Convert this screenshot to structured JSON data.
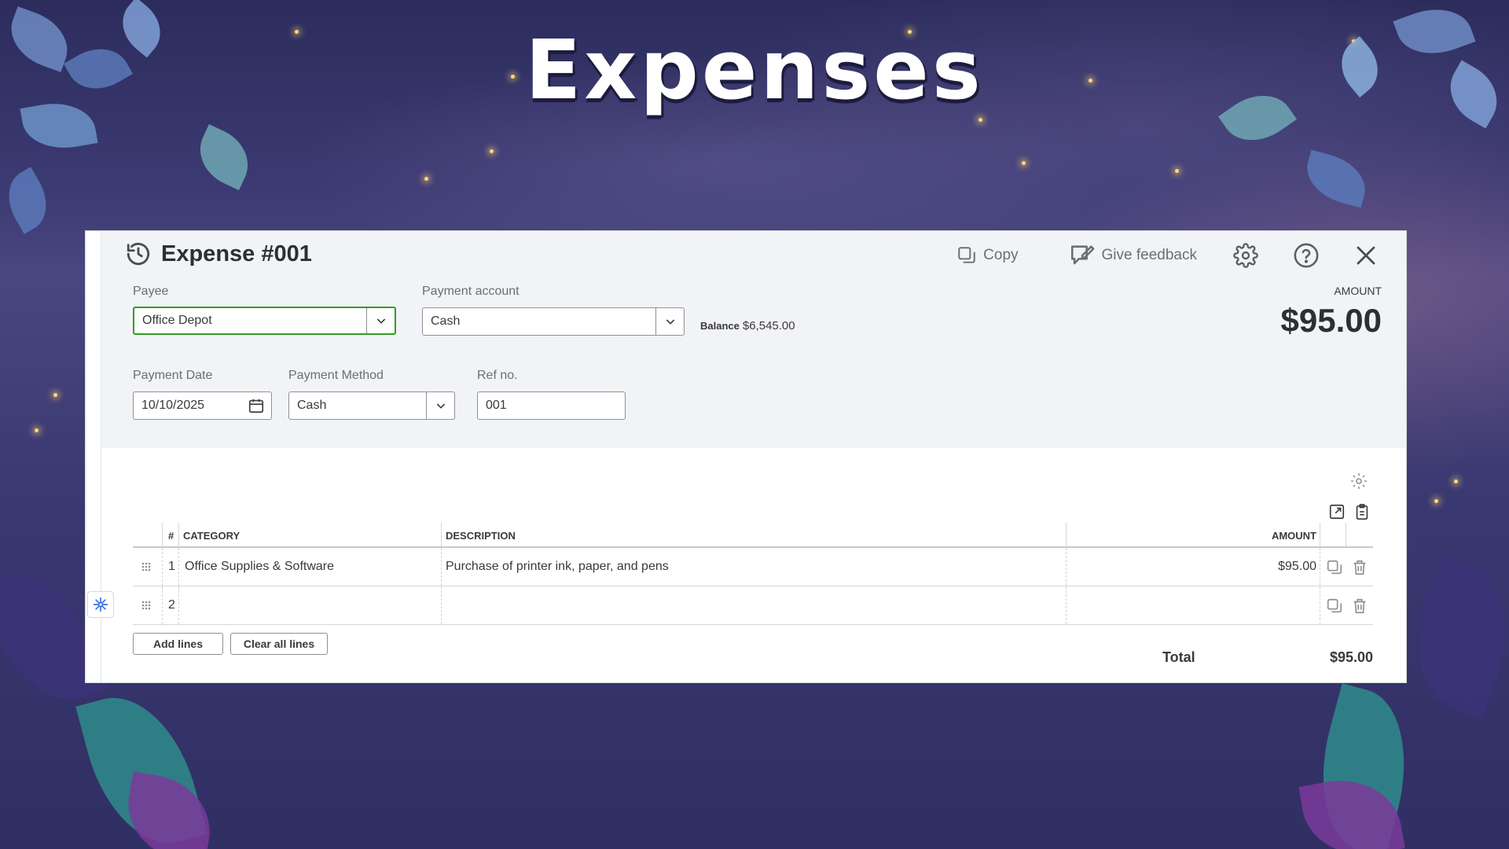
{
  "page": {
    "title": "Expenses"
  },
  "colors": {
    "accent_green": "#2ca01c",
    "text_dark": "#393a3d",
    "muted": "#6b6e75"
  },
  "header": {
    "title": "Expense #001",
    "history_icon": "history-icon",
    "toolbar": {
      "copy_label": "Copy",
      "feedback_label": "Give feedback",
      "settings_icon": "gear-icon",
      "help_icon": "help-icon",
      "close_icon": "close-icon"
    }
  },
  "form": {
    "payee": {
      "label": "Payee",
      "value": "Office Depot"
    },
    "payment_account": {
      "label": "Payment account",
      "value": "Cash"
    },
    "balance": {
      "label": "Balance",
      "value": "$6,545.00"
    },
    "payment_date": {
      "label": "Payment Date",
      "value": "10/10/2025"
    },
    "payment_method": {
      "label": "Payment Method",
      "value": "Cash"
    },
    "ref_no": {
      "label": "Ref no.",
      "value": "001"
    },
    "amount": {
      "label": "AMOUNT",
      "value": "$95.00"
    }
  },
  "lines": {
    "columns": {
      "num": "#",
      "category": "CATEGORY",
      "description": "DESCRIPTION",
      "amount": "AMOUNT"
    },
    "rows": [
      {
        "num": "1",
        "category": "Office Supplies & Software",
        "description": "Purchase of printer ink, paper, and pens",
        "amount": "$95.00"
      },
      {
        "num": "2",
        "category": "",
        "description": "",
        "amount": ""
      }
    ],
    "add_lines_label": "Add lines",
    "clear_lines_label": "Clear all lines",
    "total_label": "Total",
    "total_value": "$95.00"
  }
}
